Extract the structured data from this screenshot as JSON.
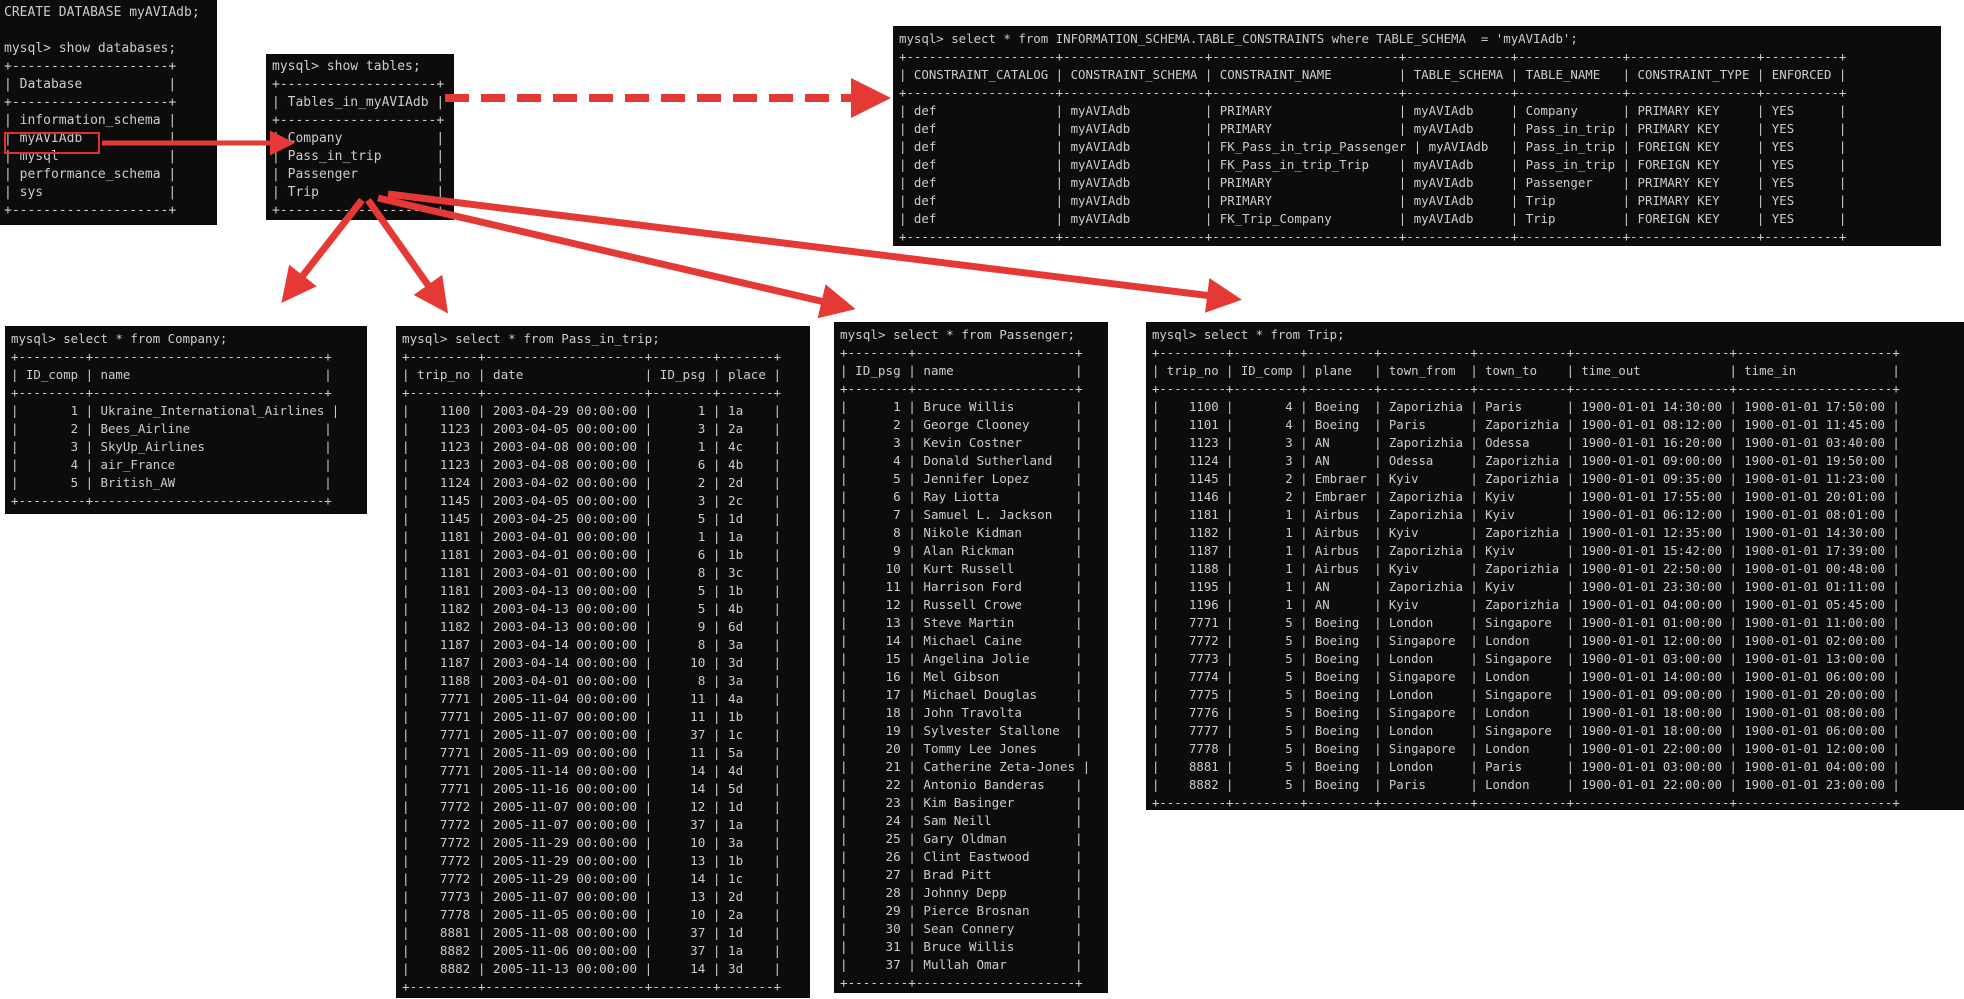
{
  "terminals": {
    "databases": {
      "lines": [
        "CREATE DATABASE myAVIAdb;",
        "",
        "mysql> show databases;",
        "+--------------------+",
        "| Database           |",
        "+--------------------+",
        "| information_schema |",
        "| myAVIAdb           |",
        "| mysql              |",
        "| performance_schema |",
        "| sys                |",
        "+--------------------+"
      ]
    },
    "tables": {
      "lines": [
        "mysql> show tables;",
        "+--------------------+",
        "| Tables_in_myAVIAdb |",
        "+--------------------+",
        "| Company            |",
        "| Pass_in_trip       |",
        "| Passenger          |",
        "| Trip               |",
        "+--------------------+"
      ]
    },
    "constraints": {
      "lines": [
        "mysql> select * from INFORMATION_SCHEMA.TABLE_CONSTRAINTS where TABLE_SCHEMA  = 'myAVIAdb';",
        "+--------------------+-------------------+-------------------------+--------------+--------------+-----------------+----------+",
        "| CONSTRAINT_CATALOG | CONSTRAINT_SCHEMA | CONSTRAINT_NAME         | TABLE_SCHEMA | TABLE_NAME   | CONSTRAINT_TYPE | ENFORCED |",
        "+--------------------+-------------------+-------------------------+--------------+--------------+-----------------+----------+",
        "| def                | myAVIAdb          | PRIMARY                 | myAVIAdb     | Company      | PRIMARY KEY     | YES      |",
        "| def                | myAVIAdb          | PRIMARY                 | myAVIAdb     | Pass_in_trip | PRIMARY KEY     | YES      |",
        "| def                | myAVIAdb          | FK_Pass_in_trip_Passenger | myAVIAdb   | Pass_in_trip | FOREIGN KEY     | YES      |",
        "| def                | myAVIAdb          | FK_Pass_in_trip_Trip    | myAVIAdb     | Pass_in_trip | FOREIGN KEY     | YES      |",
        "| def                | myAVIAdb          | PRIMARY                 | myAVIAdb     | Passenger    | PRIMARY KEY     | YES      |",
        "| def                | myAVIAdb          | PRIMARY                 | myAVIAdb     | Trip         | PRIMARY KEY     | YES      |",
        "| def                | myAVIAdb          | FK_Trip_Company         | myAVIAdb     | Trip         | FOREIGN KEY     | YES      |",
        "+--------------------+-------------------+-------------------------+--------------+--------------+-----------------+----------+"
      ]
    },
    "company": {
      "lines": [
        "mysql> select * from Company;",
        "+---------+-------------------------------+",
        "| ID_comp | name                          |",
        "+---------+-------------------------------+",
        "|       1 | Ukraine_International_Airlines |",
        "|       2 | Bees_Airline                  |",
        "|       3 | SkyUp_Airlines                |",
        "|       4 | air_France                    |",
        "|       5 | British_AW                    |",
        "+---------+-------------------------------+"
      ]
    },
    "pass_in_trip": {
      "lines": [
        "mysql> select * from Pass_in_trip;",
        "+---------+---------------------+--------+-------+",
        "| trip_no | date                | ID_psg | place |",
        "+---------+---------------------+--------+-------+",
        "|    1100 | 2003-04-29 00:00:00 |      1 | 1a    |",
        "|    1123 | 2003-04-05 00:00:00 |      3 | 2a    |",
        "|    1123 | 2003-04-08 00:00:00 |      1 | 4c    |",
        "|    1123 | 2003-04-08 00:00:00 |      6 | 4b    |",
        "|    1124 | 2003-04-02 00:00:00 |      2 | 2d    |",
        "|    1145 | 2003-04-05 00:00:00 |      3 | 2c    |",
        "|    1145 | 2003-04-25 00:00:00 |      5 | 1d    |",
        "|    1181 | 2003-04-01 00:00:00 |      1 | 1a    |",
        "|    1181 | 2003-04-01 00:00:00 |      6 | 1b    |",
        "|    1181 | 2003-04-01 00:00:00 |      8 | 3c    |",
        "|    1181 | 2003-04-13 00:00:00 |      5 | 1b    |",
        "|    1182 | 2003-04-13 00:00:00 |      5 | 4b    |",
        "|    1182 | 2003-04-13 00:00:00 |      9 | 6d    |",
        "|    1187 | 2003-04-14 00:00:00 |      8 | 3a    |",
        "|    1187 | 2003-04-14 00:00:00 |     10 | 3d    |",
        "|    1188 | 2003-04-01 00:00:00 |      8 | 3a    |",
        "|    7771 | 2005-11-04 00:00:00 |     11 | 4a    |",
        "|    7771 | 2005-11-07 00:00:00 |     11 | 1b    |",
        "|    7771 | 2005-11-07 00:00:00 |     37 | 1c    |",
        "|    7771 | 2005-11-09 00:00:00 |     11 | 5a    |",
        "|    7771 | 2005-11-14 00:00:00 |     14 | 4d    |",
        "|    7771 | 2005-11-16 00:00:00 |     14 | 5d    |",
        "|    7772 | 2005-11-07 00:00:00 |     12 | 1d    |",
        "|    7772 | 2005-11-07 00:00:00 |     37 | 1a    |",
        "|    7772 | 2005-11-29 00:00:00 |     10 | 3a    |",
        "|    7772 | 2005-11-29 00:00:00 |     13 | 1b    |",
        "|    7772 | 2005-11-29 00:00:00 |     14 | 1c    |",
        "|    7773 | 2005-11-07 00:00:00 |     13 | 2d    |",
        "|    7778 | 2005-11-05 00:00:00 |     10 | 2a    |",
        "|    8881 | 2005-11-08 00:00:00 |     37 | 1d    |",
        "|    8882 | 2005-11-06 00:00:00 |     37 | 1a    |",
        "|    8882 | 2005-11-13 00:00:00 |     14 | 3d    |",
        "+---------+---------------------+--------+-------+"
      ]
    },
    "passenger": {
      "lines": [
        "mysql> select * from Passenger;",
        "+--------+---------------------+",
        "| ID_psg | name                |",
        "+--------+---------------------+",
        "|      1 | Bruce Willis        |",
        "|      2 | George Clooney      |",
        "|      3 | Kevin Costner       |",
        "|      4 | Donald Sutherland   |",
        "|      5 | Jennifer Lopez      |",
        "|      6 | Ray Liotta          |",
        "|      7 | Samuel L. Jackson   |",
        "|      8 | Nikole Kidman       |",
        "|      9 | Alan Rickman        |",
        "|     10 | Kurt Russell        |",
        "|     11 | Harrison Ford       |",
        "|     12 | Russell Crowe       |",
        "|     13 | Steve Martin        |",
        "|     14 | Michael Caine       |",
        "|     15 | Angelina Jolie      |",
        "|     16 | Mel Gibson          |",
        "|     17 | Michael Douglas     |",
        "|     18 | John Travolta       |",
        "|     19 | Sylvester Stallone  |",
        "|     20 | Tommy Lee Jones     |",
        "|     21 | Catherine Zeta-Jones |",
        "|     22 | Antonio Banderas    |",
        "|     23 | Kim Basinger        |",
        "|     24 | Sam Neill           |",
        "|     25 | Gary Oldman         |",
        "|     26 | Clint Eastwood      |",
        "|     27 | Brad Pitt           |",
        "|     28 | Johnny Depp         |",
        "|     29 | Pierce Brosnan      |",
        "|     30 | Sean Connery        |",
        "|     31 | Bruce Willis        |",
        "|     37 | Mullah Omar         |",
        "+--------+---------------------+"
      ]
    },
    "trip": {
      "lines": [
        "mysql> select * from Trip;",
        "+---------+---------+---------+------------+------------+---------------------+---------------------+",
        "| trip_no | ID_comp | plane   | town_from  | town_to    | time_out            | time_in             |",
        "+---------+---------+---------+------------+------------+---------------------+---------------------+",
        "|    1100 |       4 | Boeing  | Zaporizhia | Paris      | 1900-01-01 14:30:00 | 1900-01-01 17:50:00 |",
        "|    1101 |       4 | Boeing  | Paris      | Zaporizhia | 1900-01-01 08:12:00 | 1900-01-01 11:45:00 |",
        "|    1123 |       3 | AN      | Zaporizhia | Odessa     | 1900-01-01 16:20:00 | 1900-01-01 03:40:00 |",
        "|    1124 |       3 | AN      | Odessa     | Zaporizhia | 1900-01-01 09:00:00 | 1900-01-01 19:50:00 |",
        "|    1145 |       2 | Embraer | Kyiv       | Zaporizhia | 1900-01-01 09:35:00 | 1900-01-01 11:23:00 |",
        "|    1146 |       2 | Embraer | Zaporizhia | Kyiv       | 1900-01-01 17:55:00 | 1900-01-01 20:01:00 |",
        "|    1181 |       1 | Airbus  | Zaporizhia | Kyiv       | 1900-01-01 06:12:00 | 1900-01-01 08:01:00 |",
        "|    1182 |       1 | Airbus  | Kyiv       | Zaporizhia | 1900-01-01 12:35:00 | 1900-01-01 14:30:00 |",
        "|    1187 |       1 | Airbus  | Zaporizhia | Kyiv       | 1900-01-01 15:42:00 | 1900-01-01 17:39:00 |",
        "|    1188 |       1 | Airbus  | Kyiv       | Zaporizhia | 1900-01-01 22:50:00 | 1900-01-01 00:48:00 |",
        "|    1195 |       1 | AN      | Zaporizhia | Kyiv       | 1900-01-01 23:30:00 | 1900-01-01 01:11:00 |",
        "|    1196 |       1 | AN      | Kyiv       | Zaporizhia | 1900-01-01 04:00:00 | 1900-01-01 05:45:00 |",
        "|    7771 |       5 | Boeing  | London     | Singapore  | 1900-01-01 01:00:00 | 1900-01-01 11:00:00 |",
        "|    7772 |       5 | Boeing  | Singapore  | London     | 1900-01-01 12:00:00 | 1900-01-01 02:00:00 |",
        "|    7773 |       5 | Boeing  | London     | Singapore  | 1900-01-01 03:00:00 | 1900-01-01 13:00:00 |",
        "|    7774 |       5 | Boeing  | Singapore  | London     | 1900-01-01 14:00:00 | 1900-01-01 06:00:00 |",
        "|    7775 |       5 | Boeing  | London     | Singapore  | 1900-01-01 09:00:00 | 1900-01-01 20:00:00 |",
        "|    7776 |       5 | Boeing  | Singapore  | London     | 1900-01-01 18:00:00 | 1900-01-01 08:00:00 |",
        "|    7777 |       5 | Boeing  | London     | Singapore  | 1900-01-01 18:00:00 | 1900-01-01 06:00:00 |",
        "|    7778 |       5 | Boeing  | Singapore  | London     | 1900-01-01 22:00:00 | 1900-01-01 12:00:00 |",
        "|    8881 |       5 | Boeing  | London     | Paris      | 1900-01-01 03:00:00 | 1900-01-01 04:00:00 |",
        "|    8882 |       5 | Boeing  | Paris      | London     | 1900-01-01 22:00:00 | 1900-01-01 23:00:00 |",
        "+---------+---------+---------+------------+------------+---------------------+---------------------+"
      ]
    }
  },
  "colors": {
    "terminal_bg": "#0c0c0c",
    "terminal_fg": "#cccccc",
    "arrow": "#e53935"
  }
}
